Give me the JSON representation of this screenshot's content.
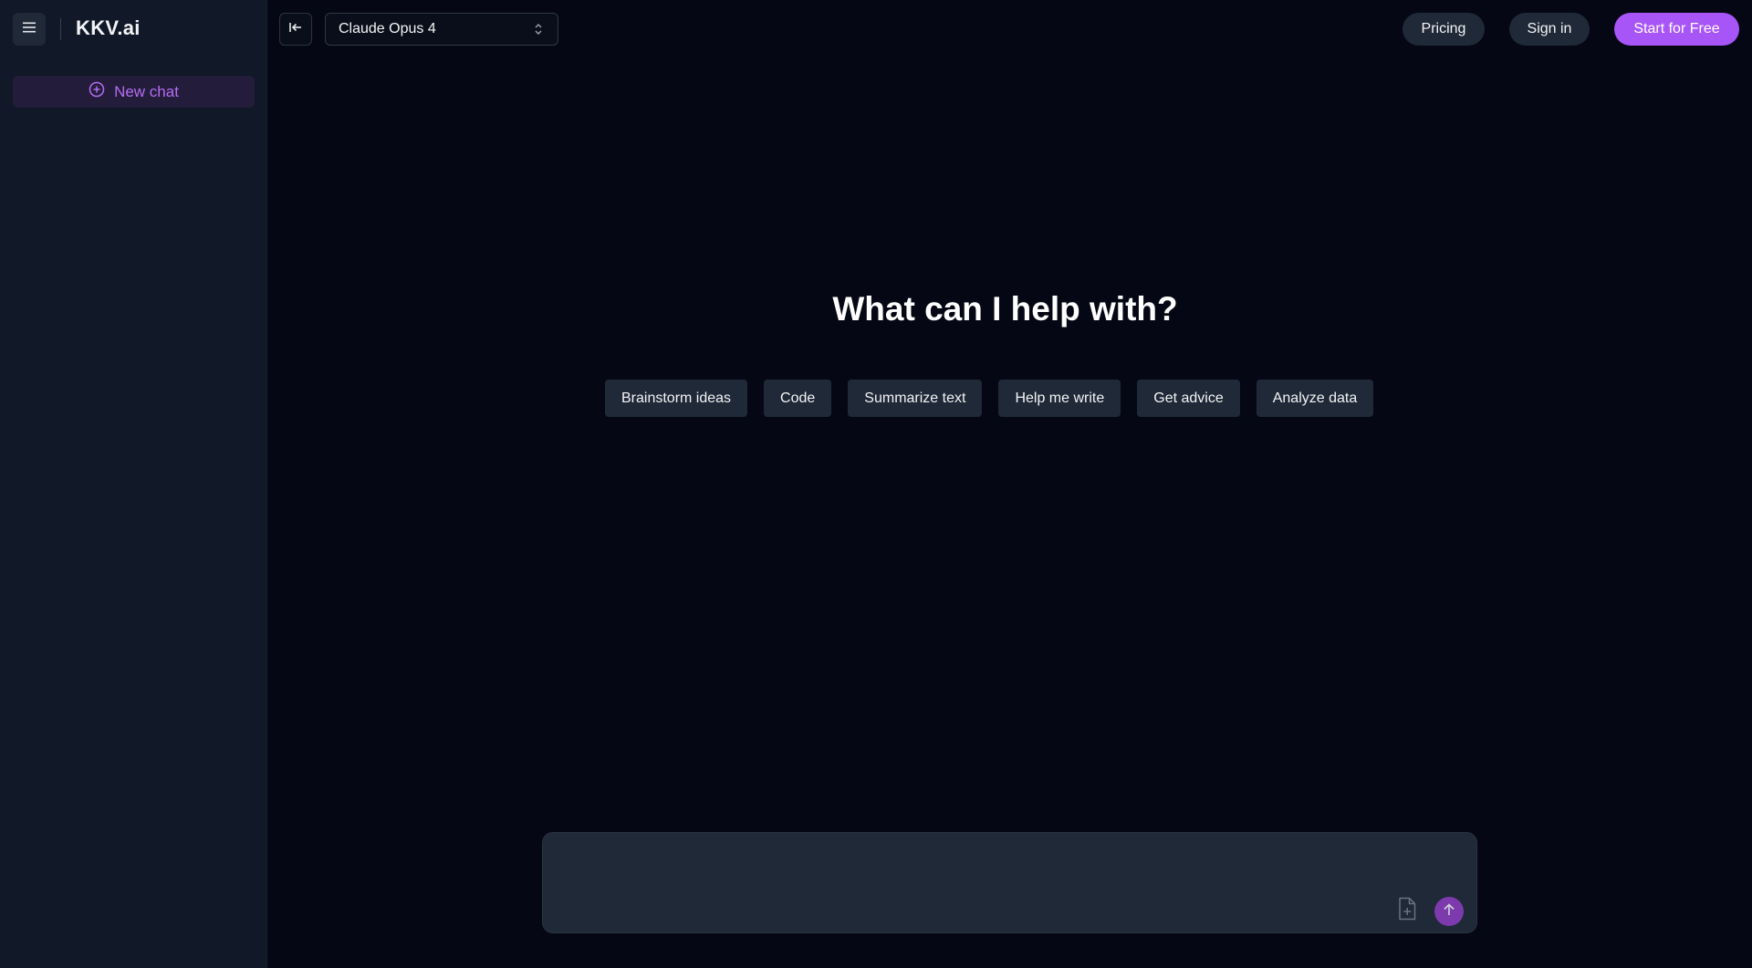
{
  "sidebar": {
    "brand": "KKV.ai",
    "new_chat_label": "New chat",
    "menu_icon": "hamburger-icon",
    "new_chat_icon": "plus-circle-icon"
  },
  "topbar": {
    "collapse_icon": "collapse-sidebar-icon",
    "model": {
      "selected": "Claude Opus 4",
      "icon": "chevron-up-down-icon"
    },
    "pricing_label": "Pricing",
    "signin_label": "Sign in",
    "start_label": "Start for Free"
  },
  "main": {
    "headline": "What can I help with?",
    "suggestions": [
      {
        "label": "Brainstorm ideas"
      },
      {
        "label": "Code"
      },
      {
        "label": "Summarize text"
      },
      {
        "label": "Help me write"
      },
      {
        "label": "Get advice"
      },
      {
        "label": "Analyze data"
      }
    ]
  },
  "composer": {
    "value": "",
    "placeholder": "",
    "attach_icon": "file-plus-icon",
    "send_icon": "arrow-up-icon"
  },
  "colors": {
    "background": "#050814",
    "sidebar": "#111827",
    "accent": "#a855f7",
    "chip": "#1f2937"
  }
}
